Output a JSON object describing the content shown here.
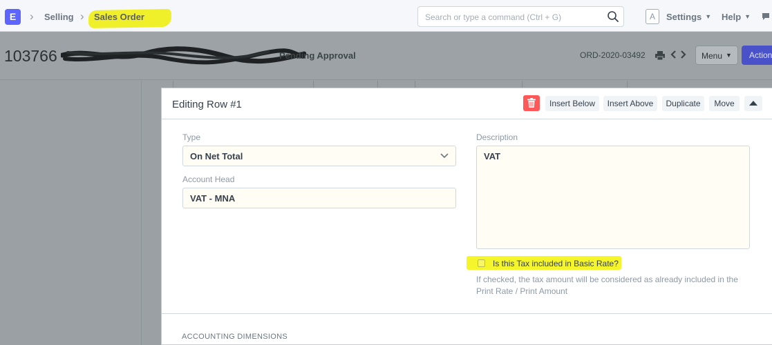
{
  "navbar": {
    "logo_letter": "E",
    "breadcrumbs": [
      "Selling",
      "Sales Order"
    ],
    "search_placeholder": "Search or type a command (Ctrl + G)",
    "avatar_letter": "A",
    "settings_label": "Settings",
    "help_label": "Help"
  },
  "page_header": {
    "title_number": "103766",
    "status": "Pending Approval",
    "order_id": "ORD-2020-03492",
    "menu_label": "Menu",
    "actions_label": "Action"
  },
  "editor": {
    "title": "Editing Row #1",
    "buttons": {
      "insert_below": "Insert Below",
      "insert_above": "Insert Above",
      "duplicate": "Duplicate",
      "move": "Move"
    },
    "fields": {
      "type": {
        "label": "Type",
        "value": "On Net Total"
      },
      "account_head": {
        "label": "Account Head",
        "value": "VAT - MNA"
      },
      "description": {
        "label": "Description",
        "value": "VAT"
      }
    },
    "checkbox": {
      "label": "Is this Tax included in Basic Rate?",
      "checked": false,
      "help": "If checked, the tax amount will be considered as already included in the Print Rate / Print Amount"
    },
    "section_title": "ACCOUNTING DIMENSIONS"
  },
  "colors": {
    "brand": "#5e64ff",
    "highlight": "#f5f52c",
    "delete": "#ff5858",
    "overlay": "#9aa0a3"
  }
}
